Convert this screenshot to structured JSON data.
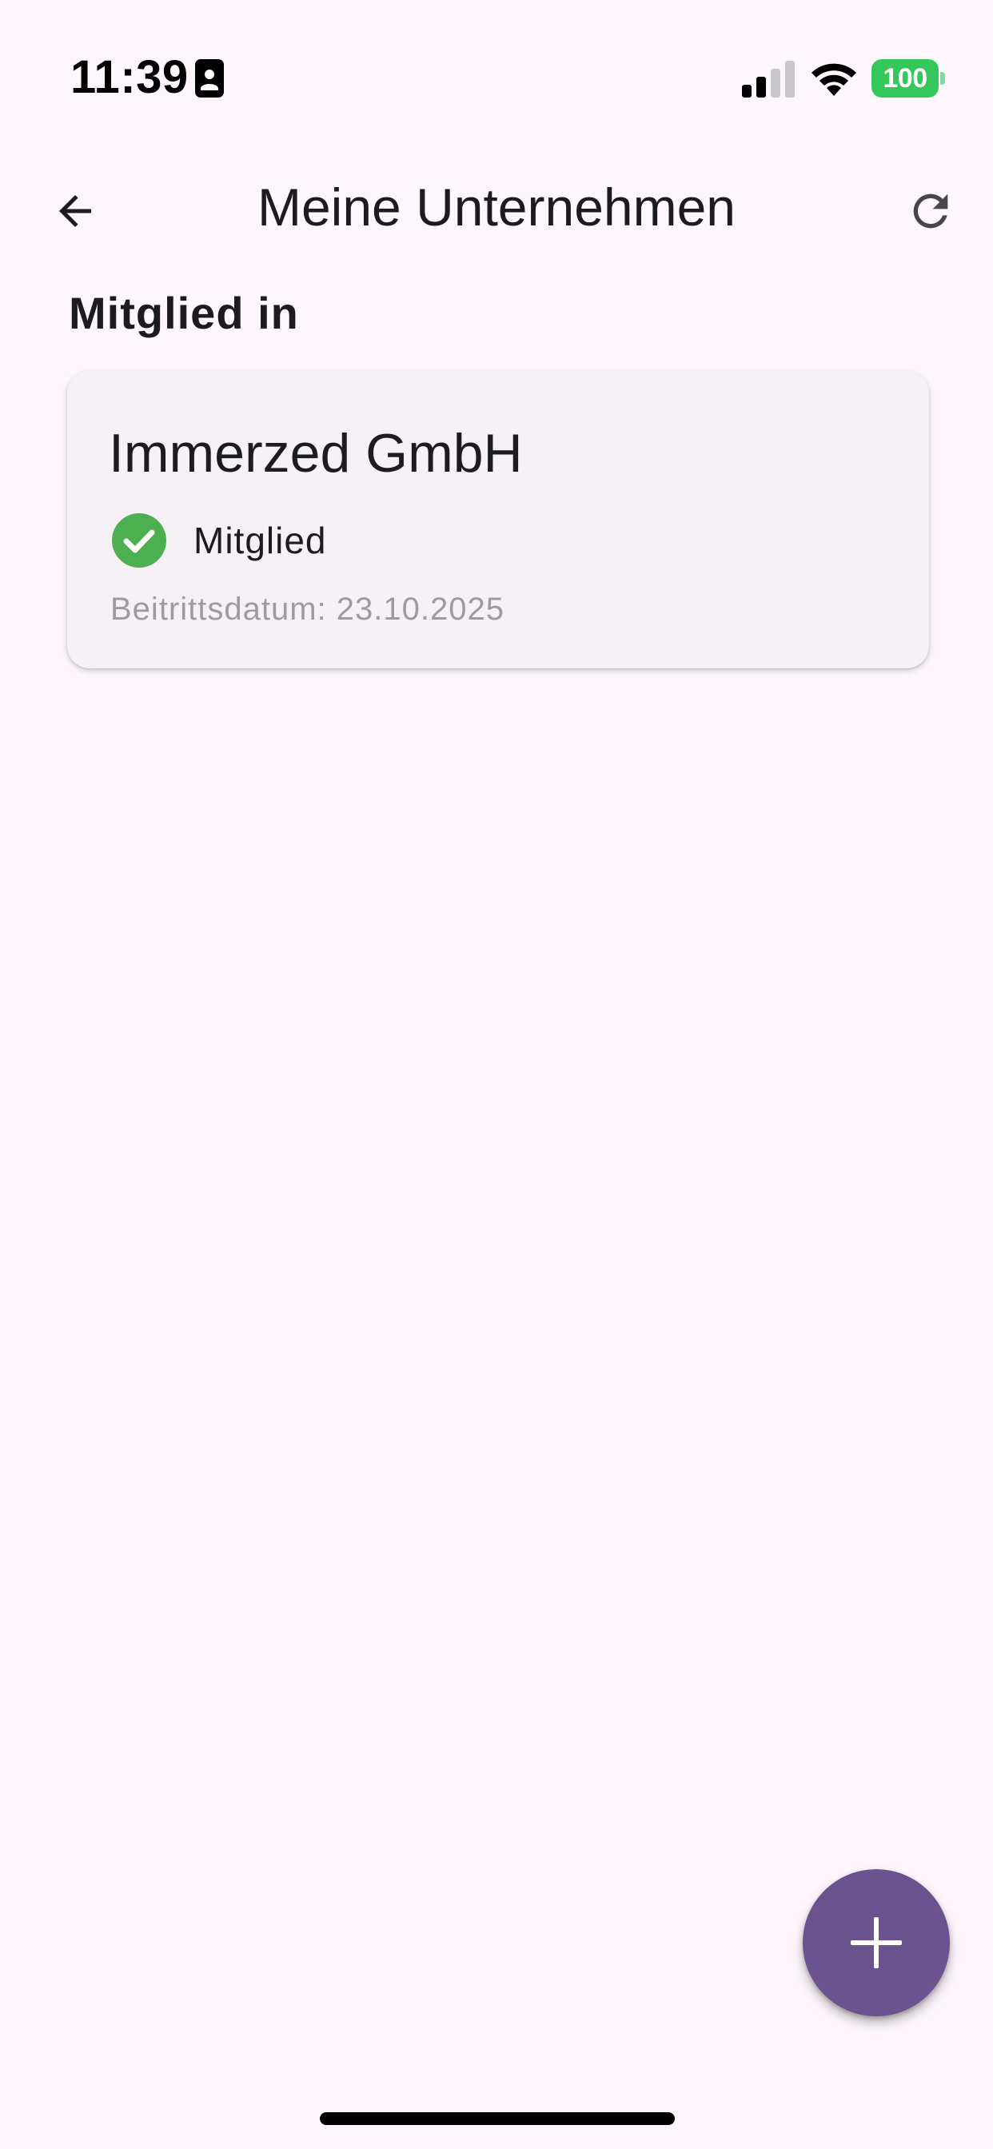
{
  "status_bar": {
    "time": "11:39",
    "battery_level": "100",
    "battery_color": "#34c759",
    "signal_bars_active": 2,
    "signal_bars_total": 4,
    "icons": [
      "contact-card-icon",
      "signal-icon",
      "wifi-icon",
      "battery-icon"
    ]
  },
  "app_bar": {
    "title": "Meine Unternehmen",
    "back_icon": "arrow-left-icon",
    "refresh_icon": "refresh-icon"
  },
  "section": {
    "heading": "Mitglied in"
  },
  "companies": [
    {
      "name": "Immerzed GmbH",
      "status_label": "Mitglied",
      "status_icon": "check-circle-icon",
      "status_color": "#4caf50",
      "join_date": "Beitrittsdatum: 23.10.2025"
    }
  ],
  "fab": {
    "icon": "plus-icon",
    "color": "#6b538f"
  },
  "colors": {
    "background": "#fdf7fd",
    "card_background": "#f6f1f6",
    "secondary_text": "#9e9aa0"
  }
}
